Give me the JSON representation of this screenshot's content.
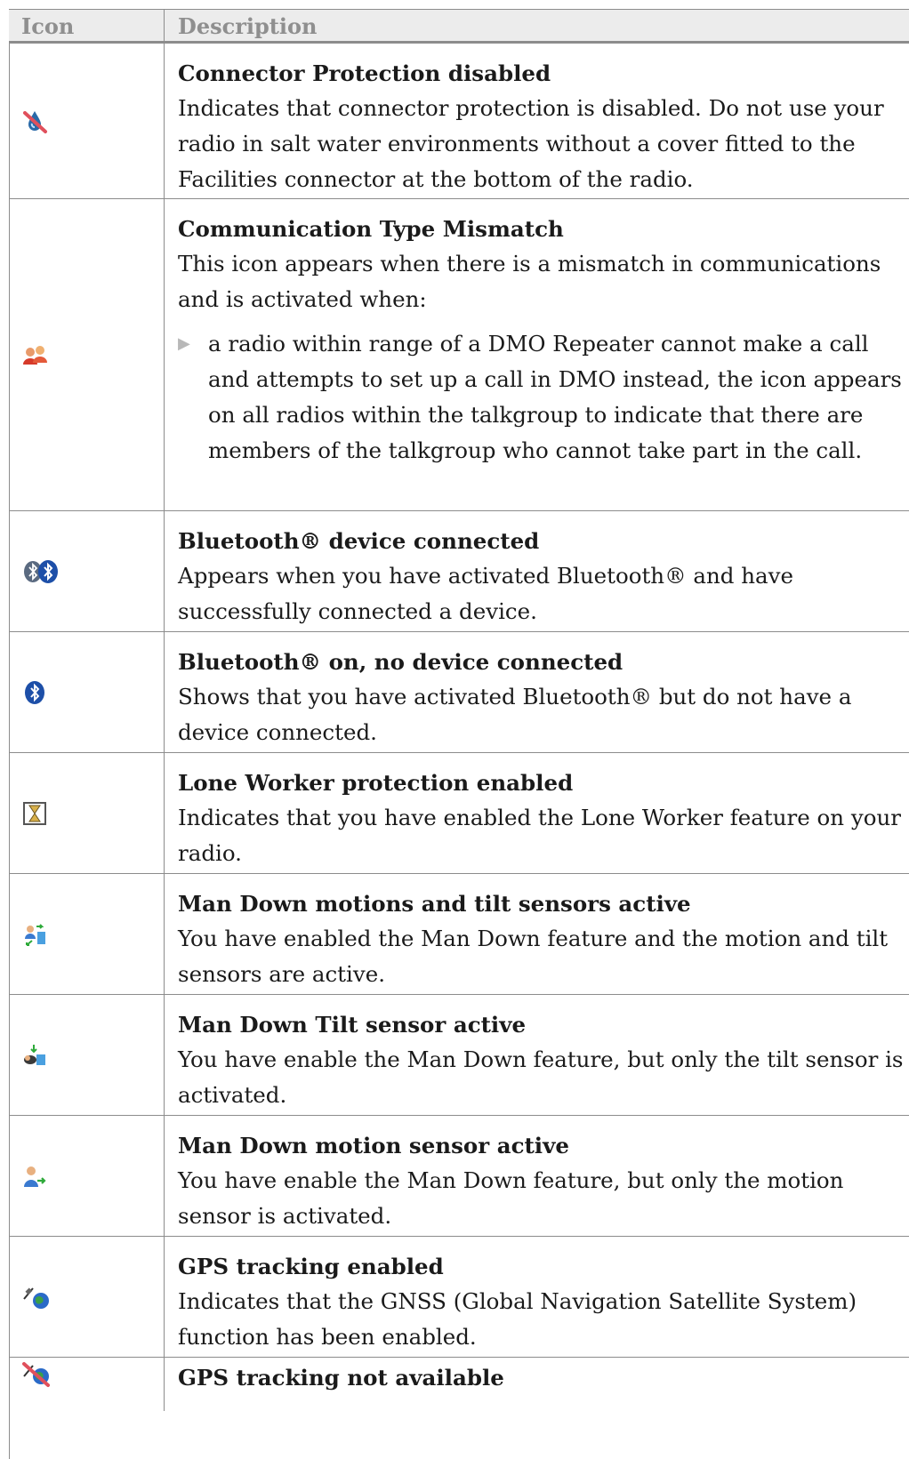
{
  "table": {
    "headers": {
      "icon": "Icon",
      "description": "Description"
    },
    "rows": [
      {
        "icon_name": "connector-protection-disabled-icon",
        "title": "Connector Protection disabled",
        "text": "Indicates that connector protection is disabled. Do not use your radio in salt water environments without a cover fitted to the Facilities connector at the bottom of the radio."
      },
      {
        "icon_name": "communication-type-mismatch-icon",
        "title": "Communication Type Mismatch",
        "text": "This icon appears when there is a mismatch in communications and is activated when:",
        "bullet": "a radio within range of a DMO Repeater cannot make a call and attempts to set up a call in DMO instead, the icon appears on all radios within the talkgroup to indicate that there are members of the talkgroup who cannot take part in the call."
      },
      {
        "icon_name": "bluetooth-device-connected-icon",
        "title": "Bluetooth® device connected",
        "text": "Appears when you have activated Bluetooth® and have successfully connected a device."
      },
      {
        "icon_name": "bluetooth-on-icon",
        "title": "Bluetooth® on, no device connected",
        "text": "Shows that you have activated Bluetooth® but do not have a device connected."
      },
      {
        "icon_name": "lone-worker-icon",
        "title": "Lone Worker protection enabled",
        "text": "Indicates that you have enabled the Lone Worker feature on your radio."
      },
      {
        "icon_name": "man-down-motion-tilt-icon",
        "title": "Man Down motions and tilt sensors active",
        "text": "You have enabled the Man Down feature and the motion and tilt sensors are active."
      },
      {
        "icon_name": "man-down-tilt-icon",
        "title": "Man Down Tilt sensor active",
        "text": "You have enable the Man Down feature, but only the tilt sensor is activated."
      },
      {
        "icon_name": "man-down-motion-icon",
        "title": "Man Down motion sensor active",
        "text": "You have enable the Man Down feature, but only the motion sensor is activated."
      },
      {
        "icon_name": "gps-tracking-enabled-icon",
        "title": "GPS tracking enabled",
        "text": "Indicates that the GNSS (Global Navigation Satellite System) function has been enabled."
      },
      {
        "icon_name": "gps-tracking-not-available-icon",
        "title": "GPS tracking not available"
      }
    ]
  }
}
